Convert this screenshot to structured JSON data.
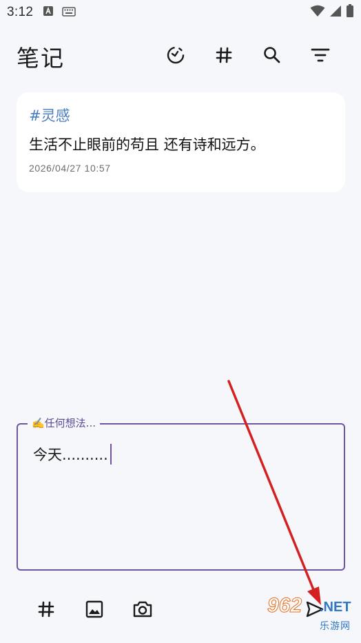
{
  "status_bar": {
    "time": "3:12",
    "icons": [
      "a-icon",
      "keyboard-icon",
      "wifi-icon",
      "signal-icon",
      "battery-icon"
    ]
  },
  "app_bar": {
    "title": "笔记",
    "actions": [
      "review-icon",
      "hashtag-icon",
      "search-icon",
      "filter-icon"
    ]
  },
  "notes": [
    {
      "tag": "#灵感",
      "content": "生活不止眼前的苟且 还有诗和远方。",
      "date": "2026/04/27 10:57"
    }
  ],
  "composer": {
    "label": "✍️任何想法...",
    "value": "今天..........",
    "accent_color": "#6e55a0"
  },
  "bottom_toolbar": {
    "buttons": [
      "hashtag-icon",
      "image-icon",
      "camera-icon",
      "send-icon"
    ]
  },
  "watermark": {
    "number": "962",
    "suffix": ".NET",
    "subtitle": "乐游网"
  },
  "colors": {
    "background": "#f6f7fb",
    "tag": "#4a7cc2",
    "annotation_arrow": "#d42020"
  }
}
